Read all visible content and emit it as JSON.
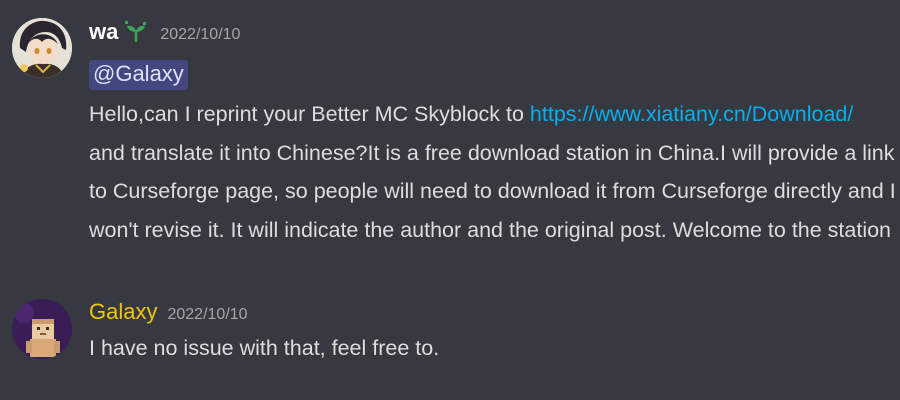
{
  "messages": [
    {
      "author": "wa",
      "author_color": "#ffffff",
      "badge_icon": "sprout-icon",
      "timestamp": "2022/10/10",
      "mention": "@Galaxy",
      "body_before_link": "Hello,can I reprint your  Better MC Skyblock to ",
      "link": "https://www.xiatiany.cn/Download/",
      "body_lines_after": [
        "and translate it into Chinese?It is a free download station in China.I will provide a link",
        "to Curseforge page, so people will need to download it from Curseforge directly and I",
        "won't revise it. It will indicate the author and the original post. Welcome to the station"
      ]
    },
    {
      "author": "Galaxy",
      "author_color": "#f1c40f",
      "timestamp": "2022/10/10",
      "body": "I have no issue with that, feel free to."
    }
  ],
  "colors": {
    "background": "#36393f",
    "text": "#dcddde",
    "link": "#00b0f4",
    "timestamp": "#a3a6aa",
    "mention_bg": "#5865f2"
  }
}
